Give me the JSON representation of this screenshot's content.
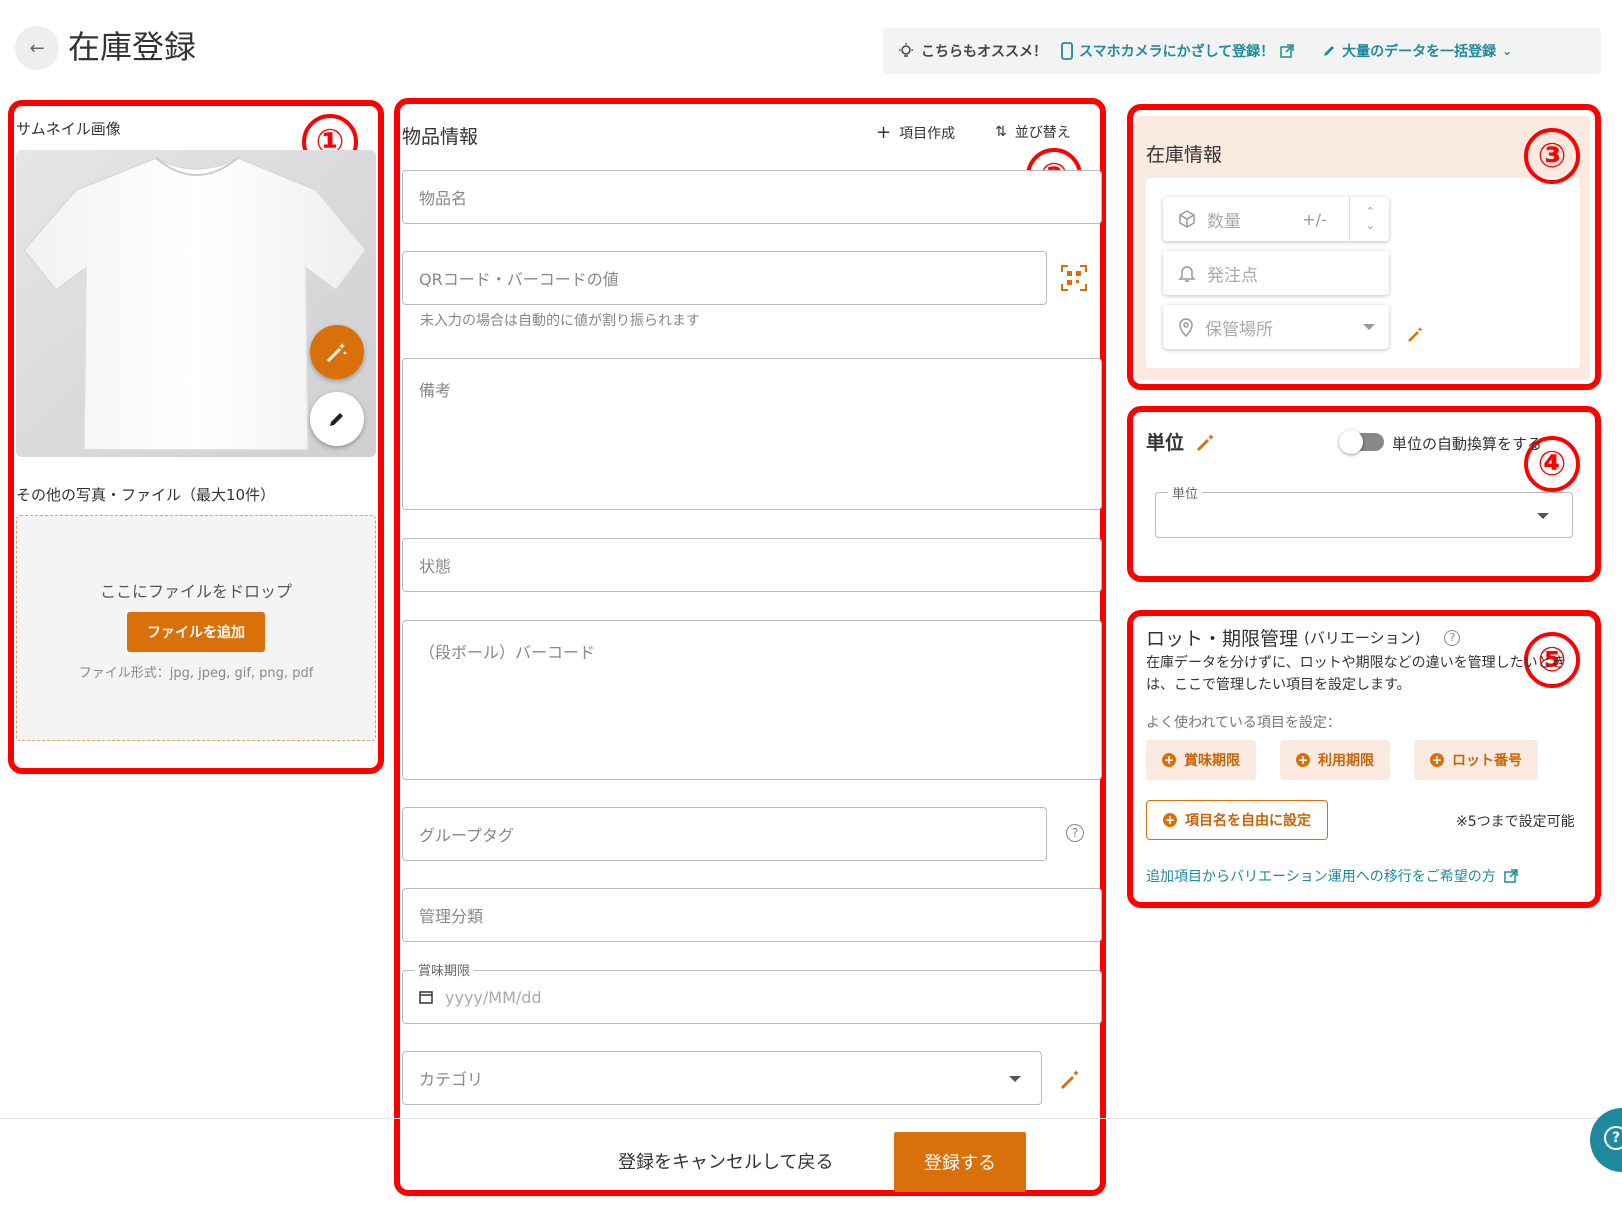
{
  "header": {
    "title": "在庫登録",
    "reco_label": "こちらもオススメ！",
    "camera_link": "スマホカメラにかざして登録！",
    "bulk_link": "大量のデータを一括登録"
  },
  "annotations": [
    "①",
    "②",
    "③",
    "④",
    "⑤"
  ],
  "thumbnail": {
    "label": "サムネイル画像",
    "other_files_label": "その他の写真・ファイル（最大10件）",
    "drop_text": "ここにファイルをドロップ",
    "add_button": "ファイルを追加",
    "formats": "ファイル形式：jpg, jpeg, gif, png, pdf"
  },
  "item_info": {
    "title": "物品情報",
    "create_field": "項目作成",
    "sort": "並び替え",
    "name_placeholder": "物品名",
    "code_placeholder": "QRコード・バーコードの値",
    "code_helper": "未入力の場合は自動的に値が割り振られます",
    "notes_placeholder": "備考",
    "status_placeholder": "状態",
    "case_barcode_placeholder": "（段ボール）バーコード",
    "group_tag_placeholder": "グループタグ",
    "mgmt_category_placeholder": "管理分類",
    "expiry_label": "賞味期限",
    "expiry_placeholder": "yyyy/MM/dd",
    "category_placeholder": "カテゴリ",
    "cancel": "登録をキャンセルして戻る",
    "submit": "登録する"
  },
  "stock_info": {
    "title": "在庫情報",
    "quantity": "数量",
    "quantity_toggle": "+/-",
    "reorder_point": "発注点",
    "location": "保管場所"
  },
  "unit": {
    "title": "単位",
    "auto_convert": "単位の自動換算をする",
    "field_label": "単位"
  },
  "lot": {
    "title": "ロット・期限管理",
    "title_suffix": "(バリエーション)",
    "desc": "在庫データを分けずに、ロットや期限などの違いを管理したいときは、ここで管理したい項目を設定します。",
    "common_label": "よく使われている項目を設定：",
    "chips": [
      "賞味期限",
      "利用期限",
      "ロット番号"
    ],
    "free_chip": "項目名を自由に設定",
    "limit_note": "※5つまで設定可能",
    "migrate_link": "追加項目からバリエーション運用への移行をご希望の方"
  },
  "colors": {
    "accent": "#d9700a",
    "link": "#1f8a9e",
    "annotation": "#ff0000",
    "stock_bg": "#fbeadf"
  }
}
